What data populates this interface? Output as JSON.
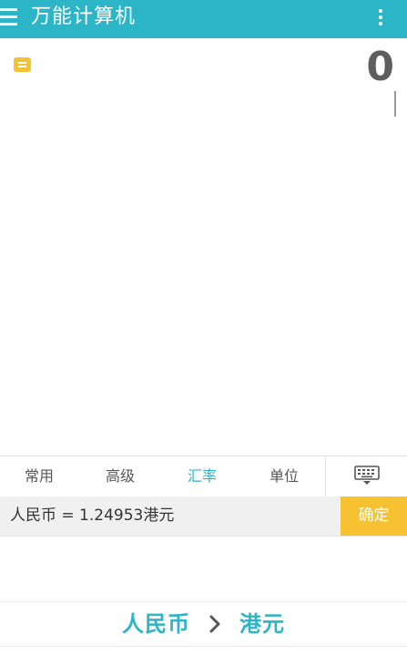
{
  "appbar": {
    "title": "万能计算机"
  },
  "display": {
    "value": "0"
  },
  "tabs": [
    {
      "label": "常用"
    },
    {
      "label": "高级"
    },
    {
      "label": "汇率",
      "active": true
    },
    {
      "label": "单位"
    }
  ],
  "input": {
    "expression": "人民币 = 1.24953港元",
    "confirm_label": "确定"
  },
  "conversion": {
    "from": "人民币",
    "to": "港元"
  },
  "icons": {
    "menu": "hamburger-menu-icon",
    "more": "more-vertical-icon",
    "history": "history-list-icon",
    "keyboard": "keyboard-hide-icon",
    "arrow": "chevron-right-icon"
  },
  "colors": {
    "primary": "#2cb5c7",
    "accent": "#f6c232",
    "text": "#555555"
  }
}
